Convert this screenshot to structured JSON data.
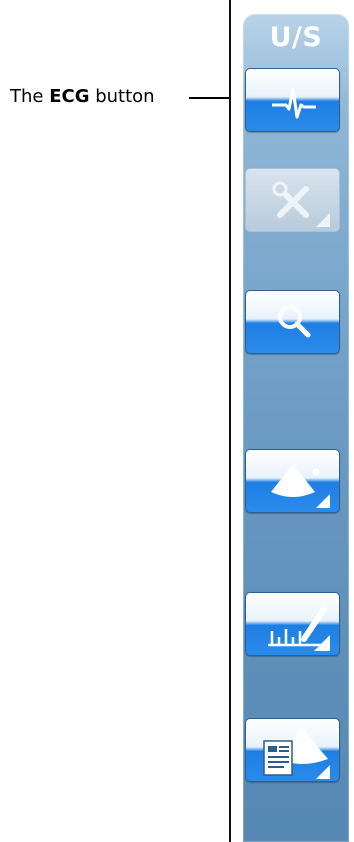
{
  "callout": {
    "prefix": "The ",
    "bold": "ECG",
    "suffix": " button"
  },
  "panel": {
    "title": "U/S"
  },
  "buttons": [
    {
      "name": "ecg-button",
      "icon": "ecg-waveform-icon",
      "state": "active"
    },
    {
      "name": "tools-button",
      "icon": "wrench-screwdriver-icon",
      "state": "disabled"
    },
    {
      "name": "zoom-button",
      "icon": "magnifier-icon",
      "state": "active"
    },
    {
      "name": "sector-button",
      "icon": "ultrasound-sector-icon",
      "state": "active"
    },
    {
      "name": "measure-button",
      "icon": "measure-pencil-icon",
      "state": "active"
    },
    {
      "name": "report-button",
      "icon": "report-document-icon",
      "state": "active"
    }
  ],
  "colors": {
    "panel_top": "#b9d3e8",
    "panel_bottom": "#5688b4",
    "button_blue": "#1e7fe3",
    "disabled_gray": "#c8d7e4"
  }
}
